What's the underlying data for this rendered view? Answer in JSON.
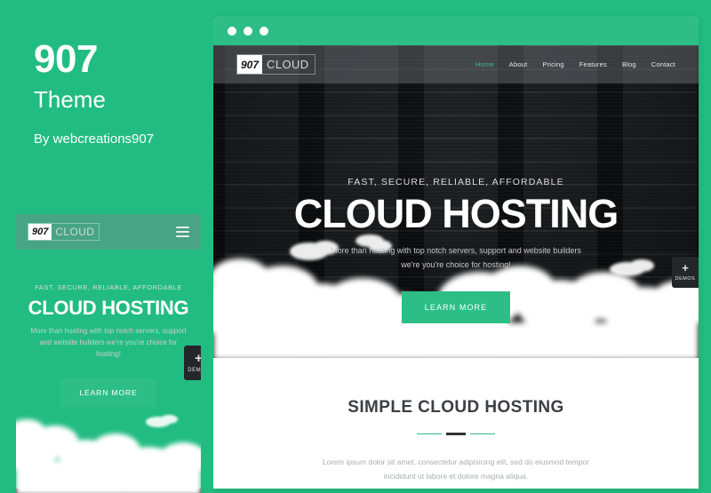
{
  "brand": {
    "number": "907",
    "theme": "Theme",
    "author": "By webcreations907"
  },
  "colors": {
    "accent_green": "#2dbe87",
    "background_green": "#22bc82",
    "hero_dark": "#1e2125",
    "demos_dark": "#242729"
  },
  "window_controls": {
    "dots": [
      "close",
      "minimize",
      "maximize"
    ]
  },
  "site": {
    "logo": {
      "number": "907",
      "word": "CLOUD"
    },
    "nav": [
      {
        "label": "Home",
        "active": true
      },
      {
        "label": "About",
        "active": false
      },
      {
        "label": "Pricing",
        "active": false
      },
      {
        "label": "Features",
        "active": false
      },
      {
        "label": "Blog",
        "active": false
      },
      {
        "label": "Contact",
        "active": false
      }
    ],
    "menu_icon": "hamburger-icon",
    "hero": {
      "kicker": "FAST, SECURE, RELIABLE, AFFORDABLE",
      "title": "CLOUD HOSTING",
      "subtitle": "More than hosting with top notch servers, support and website builders we're you're choice for hosting!",
      "button": "LEARN MORE"
    },
    "section": {
      "title": "SIMPLE CLOUD HOSTING",
      "text": "Lorem ipsum dolor sit amet, consectetur adipisicing elit, sed do eiusmod tempor incididunt ut labore et dolore magna aliqua."
    }
  },
  "demos_tab": {
    "plus": "+",
    "label": "DEMOS"
  }
}
